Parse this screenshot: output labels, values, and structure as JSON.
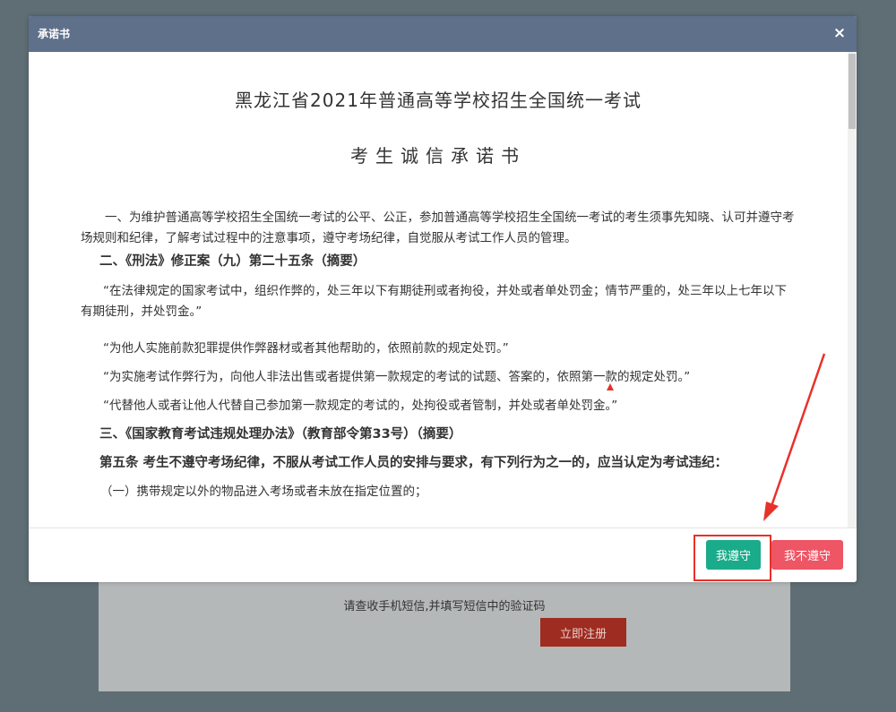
{
  "background": {
    "sms_hint": "请查收手机短信,并填写短信中的验证码",
    "register_label": "立即注册"
  },
  "modal": {
    "title": "承诺书",
    "close_symbol": "×",
    "doc_title": "黑龙江省2021年普通高等学校招生全国统一考试",
    "doc_subtitle": "考生诚信承诺书",
    "paragraphs": [
      "一、为维护普通高等学校招生全国统一考试的公平、公正，参加普通高等学校招生全国统一考试的考生须事先知晓、认可并遵守考场规则和纪律，了解考试过程中的注意事项，遵守考场纪律，自觉服从考试工作人员的管理。",
      "二、《刑法》修正案（九）第二十五条（摘要）",
      "“在法律规定的国家考试中，组织作弊的，处三年以下有期徒刑或者拘役，并处或者单处罚金；情节严重的，处三年以上七年以下有期徒刑，并处罚金。”",
      "“为他人实施前款犯罪提供作弊器材或者其他帮助的，依照前款的规定处罚。”",
      "“为实施考试作弊行为，向他人非法出售或者提供第一款规定的考试的试题、答案的，依照第一款的规定处罚。”",
      "“代替他人或者让他人代替自己参加第一款规定的考试的，处拘役或者管制，并处或者单处罚金。”",
      "三、《国家教育考试违规处理办法》（教育部令第33号）（摘要）",
      "第五条 考生不遵守考场纪律，不服从考试工作人员的安排与要求，有下列行为之一的，应当认定为考试违纪：",
      "（一）携带规定以外的物品进入考场或者未放在指定位置的；"
    ],
    "agree_label": "我遵守",
    "disagree_label": "我不遵守"
  },
  "colors": {
    "header_bg": "#5e708a",
    "agree_bg": "#1aab8a",
    "disagree_bg": "#ee5565",
    "annotation_red": "#e8312a"
  }
}
